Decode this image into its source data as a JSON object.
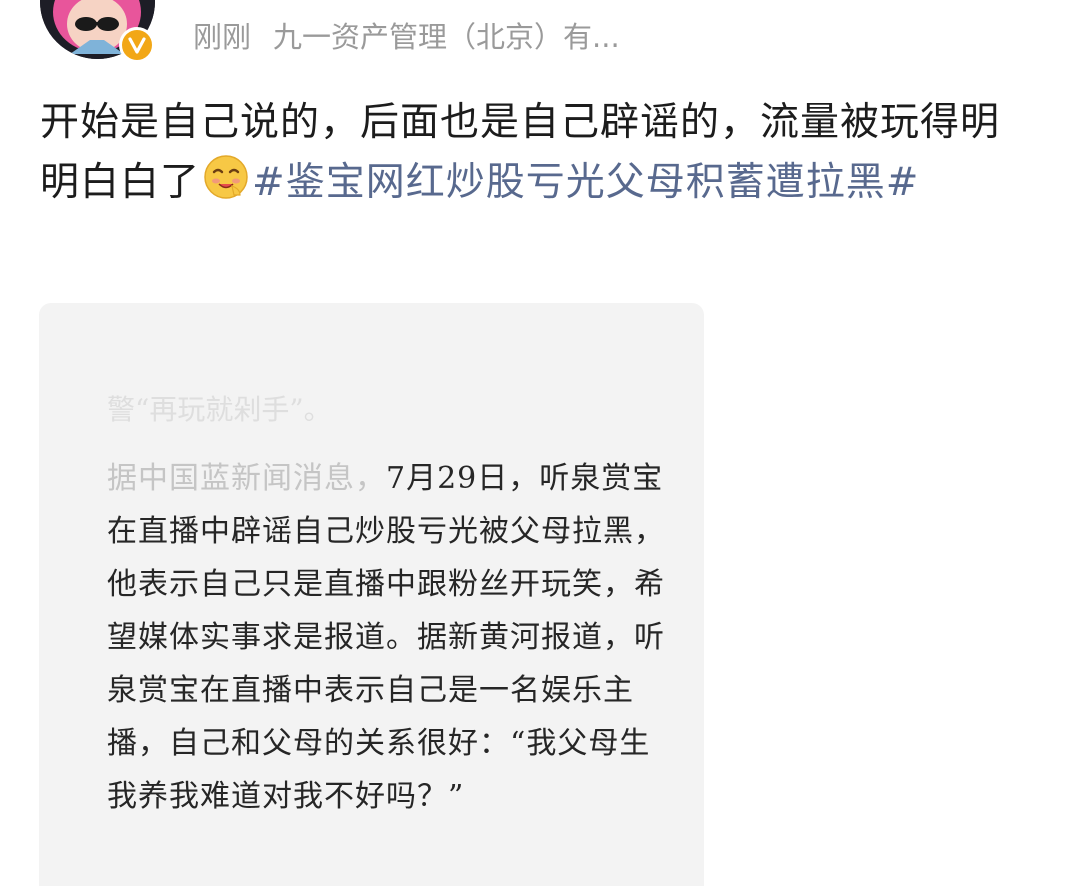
{
  "header": {
    "time": "刚刚",
    "source": "九一资产管理（北京）有...",
    "verified_icon": "v-badge-icon"
  },
  "post": {
    "text_main": "开始是自己说的，后面也是自己辟谣的，流量被玩得明明白白了",
    "emoji": "smirking-face-emoji",
    "hashtag": "#鉴宝网红炒股亏光父母积蓄遭拉黑#"
  },
  "card": {
    "faded_top": "警“再玩就剁手”。",
    "faded_prefix": "据中国蓝新闻消息，",
    "body": "7月29日，听泉赏宝在直播中辟谣自己炒股亏光被父母拉黑，他表示自己只是直播中跟粉丝开玩笑，希望媒体实事求是报道。据新黄河报道，听泉赏宝在直播中表示自己是一名娱乐主播，自己和父母的关系很好：“我父母生我养我难道对我不好吗？”"
  },
  "colors": {
    "hashtag": "#58698e",
    "verified_badge": "#f2a716",
    "meta_text": "#9a9a9a",
    "card_bg": "#f3f3f3"
  }
}
